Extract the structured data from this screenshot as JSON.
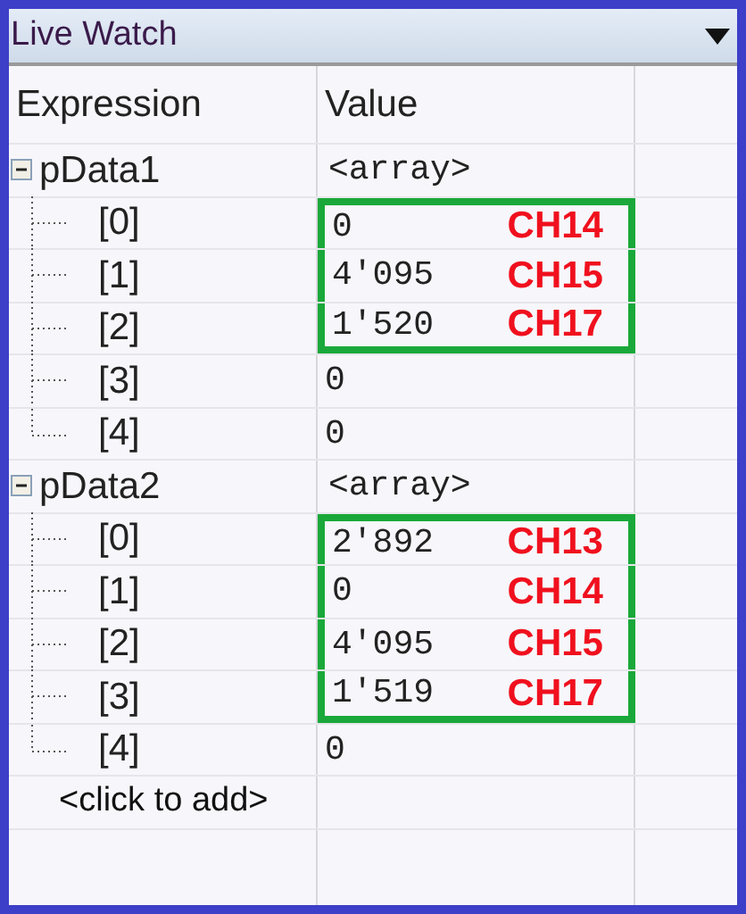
{
  "window": {
    "title": "Live Watch"
  },
  "columns": [
    "Expression",
    "Value"
  ],
  "groups": [
    {
      "name": "pData1",
      "value": "<array>",
      "expanded": true,
      "children": [
        {
          "index": "[0]",
          "value": "0",
          "highlighted": true,
          "annotation": "CH14"
        },
        {
          "index": "[1]",
          "value": "4'095",
          "highlighted": true,
          "annotation": "CH15"
        },
        {
          "index": "[2]",
          "value": "1'520",
          "highlighted": true,
          "annotation": "CH17"
        },
        {
          "index": "[3]",
          "value": "0",
          "highlighted": false
        },
        {
          "index": "[4]",
          "value": "0",
          "highlighted": false
        }
      ]
    },
    {
      "name": "pData2",
      "value": "<array>",
      "expanded": true,
      "children": [
        {
          "index": "[0]",
          "value": "2'892",
          "highlighted": true,
          "annotation": "CH13"
        },
        {
          "index": "[1]",
          "value": "0",
          "highlighted": true,
          "annotation": "CH14"
        },
        {
          "index": "[2]",
          "value": "4'095",
          "highlighted": true,
          "annotation": "CH15"
        },
        {
          "index": "[3]",
          "value": "1'519",
          "highlighted": true,
          "annotation": "CH17"
        },
        {
          "index": "[4]",
          "value": "0",
          "highlighted": false
        }
      ]
    }
  ],
  "add_row": "<click to add>"
}
